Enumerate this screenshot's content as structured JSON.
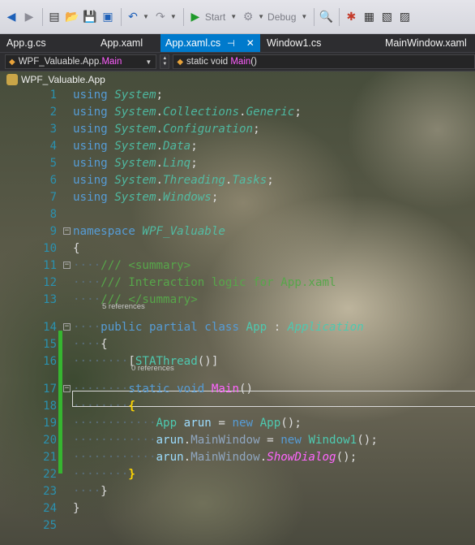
{
  "toolbar": {
    "start_label": "Start",
    "config_label": "Debug"
  },
  "tabs": [
    {
      "label": "App.g.cs",
      "active": false
    },
    {
      "label": "App.xaml",
      "active": false
    },
    {
      "label": "App.xaml.cs",
      "active": true
    },
    {
      "label": "Window1.cs",
      "active": false
    },
    {
      "label": "MainWindow.xaml",
      "active": false
    }
  ],
  "navbar": {
    "type_combo": {
      "ns": "WPF_Valuable",
      "cls": "App",
      "member": "Main"
    },
    "member_combo": {
      "prefix": "static void ",
      "name": "Main",
      "suffix": "()"
    }
  },
  "scope_label": "WPF_Valuable.App",
  "codelens": {
    "class_refs": "5 references",
    "main_refs": "0 references"
  },
  "colors": {
    "accent_tab": "#007acc",
    "line_numbers": "#2b91af",
    "keyword": "#569cd6",
    "type": "#4ec9b0",
    "comment": "#57a64a",
    "method": "#ff66ff",
    "changed_lines": "#36b530"
  },
  "lines": [
    {
      "n": "1",
      "parts": [
        {
          "t": "using ",
          "c": "kw"
        },
        {
          "t": "System",
          "c": "ns"
        },
        {
          "t": ";",
          "c": ""
        }
      ]
    },
    {
      "n": "2",
      "parts": [
        {
          "t": "using ",
          "c": "kw"
        },
        {
          "t": "System",
          "c": "ns"
        },
        {
          "t": ".",
          "c": ""
        },
        {
          "t": "Collections",
          "c": "ns"
        },
        {
          "t": ".",
          "c": ""
        },
        {
          "t": "Generic",
          "c": "ns"
        },
        {
          "t": ";",
          "c": ""
        }
      ]
    },
    {
      "n": "3",
      "parts": [
        {
          "t": "using ",
          "c": "kw"
        },
        {
          "t": "System",
          "c": "ns"
        },
        {
          "t": ".",
          "c": ""
        },
        {
          "t": "Configuration",
          "c": "ns"
        },
        {
          "t": ";",
          "c": ""
        }
      ]
    },
    {
      "n": "4",
      "parts": [
        {
          "t": "using ",
          "c": "kw"
        },
        {
          "t": "System",
          "c": "ns"
        },
        {
          "t": ".",
          "c": ""
        },
        {
          "t": "Data",
          "c": "ns"
        },
        {
          "t": ";",
          "c": ""
        }
      ]
    },
    {
      "n": "5",
      "parts": [
        {
          "t": "using ",
          "c": "kw"
        },
        {
          "t": "System",
          "c": "ns"
        },
        {
          "t": ".",
          "c": ""
        },
        {
          "t": "Linq",
          "c": "ns"
        },
        {
          "t": ";",
          "c": ""
        }
      ]
    },
    {
      "n": "6",
      "parts": [
        {
          "t": "using ",
          "c": "kw"
        },
        {
          "t": "System",
          "c": "ns"
        },
        {
          "t": ".",
          "c": ""
        },
        {
          "t": "Threading",
          "c": "ns"
        },
        {
          "t": ".",
          "c": ""
        },
        {
          "t": "Tasks",
          "c": "ns"
        },
        {
          "t": ";",
          "c": ""
        }
      ]
    },
    {
      "n": "7",
      "parts": [
        {
          "t": "using ",
          "c": "kw"
        },
        {
          "t": "System",
          "c": "ns"
        },
        {
          "t": ".",
          "c": ""
        },
        {
          "t": "Windows",
          "c": "ns"
        },
        {
          "t": ";",
          "c": ""
        }
      ]
    },
    {
      "n": "8",
      "parts": []
    },
    {
      "n": "9",
      "fold": "−",
      "parts": [
        {
          "t": "namespace ",
          "c": "kw"
        },
        {
          "t": "WPF_Valuable",
          "c": "ns"
        }
      ]
    },
    {
      "n": "10",
      "parts": [
        {
          "t": "{",
          "c": ""
        }
      ]
    },
    {
      "n": "11",
      "fold": "−",
      "parts": [
        {
          "t": "····",
          "c": "ws"
        },
        {
          "t": "/// <summary>",
          "c": "cm"
        }
      ]
    },
    {
      "n": "12",
      "parts": [
        {
          "t": "····",
          "c": "ws"
        },
        {
          "t": "/// Interaction logic for App.xaml",
          "c": "cm"
        }
      ]
    },
    {
      "n": "13",
      "parts": [
        {
          "t": "····",
          "c": "ws"
        },
        {
          "t": "/// </summary>",
          "c": "cm"
        }
      ]
    },
    {
      "n": "14",
      "fold": "−",
      "parts": [
        {
          "t": "····",
          "c": "ws"
        },
        {
          "t": "public partial class ",
          "c": "kw"
        },
        {
          "t": "App",
          "c": "ty"
        },
        {
          "t": " : ",
          "c": ""
        },
        {
          "t": "Application",
          "c": "tyi"
        }
      ]
    },
    {
      "n": "15",
      "parts": [
        {
          "t": "····",
          "c": "ws"
        },
        {
          "t": "{",
          "c": ""
        }
      ]
    },
    {
      "n": "16",
      "parts": [
        {
          "t": "········",
          "c": "ws"
        },
        {
          "t": "[",
          "c": ""
        },
        {
          "t": "STAThread",
          "c": "ty"
        },
        {
          "t": "()]",
          "c": ""
        }
      ]
    },
    {
      "n": "17",
      "fold": "−",
      "parts": [
        {
          "t": "········",
          "c": "ws"
        },
        {
          "t": "static void ",
          "c": "kw"
        },
        {
          "t": "Main",
          "c": "mt"
        },
        {
          "t": "()",
          "c": ""
        }
      ]
    },
    {
      "n": "18",
      "parts": [
        {
          "t": "········",
          "c": "ws"
        },
        {
          "t": "{",
          "c": "br"
        }
      ]
    },
    {
      "n": "19",
      "parts": [
        {
          "t": "············",
          "c": "ws"
        },
        {
          "t": "App",
          "c": "ty"
        },
        {
          "t": " ",
          "c": ""
        },
        {
          "t": "arun",
          "c": "id"
        },
        {
          "t": " = ",
          "c": ""
        },
        {
          "t": "new ",
          "c": "kw"
        },
        {
          "t": "App",
          "c": "ty"
        },
        {
          "t": "();",
          "c": ""
        }
      ]
    },
    {
      "n": "20",
      "parts": [
        {
          "t": "············",
          "c": "ws"
        },
        {
          "t": "arun",
          "c": "id"
        },
        {
          "t": ".",
          "c": ""
        },
        {
          "t": "MainWindow",
          "c": "pr"
        },
        {
          "t": " = ",
          "c": ""
        },
        {
          "t": "new ",
          "c": "kw"
        },
        {
          "t": "Window1",
          "c": "ty"
        },
        {
          "t": "();",
          "c": ""
        }
      ]
    },
    {
      "n": "21",
      "parts": [
        {
          "t": "············",
          "c": "ws"
        },
        {
          "t": "arun",
          "c": "id"
        },
        {
          "t": ".",
          "c": ""
        },
        {
          "t": "MainWindow",
          "c": "pr"
        },
        {
          "t": ".",
          "c": ""
        },
        {
          "t": "ShowDialog",
          "c": "mti"
        },
        {
          "t": "();",
          "c": ""
        }
      ]
    },
    {
      "n": "22",
      "parts": [
        {
          "t": "········",
          "c": "ws"
        },
        {
          "t": "}",
          "c": "br"
        }
      ]
    },
    {
      "n": "23",
      "parts": [
        {
          "t": "····",
          "c": "ws"
        },
        {
          "t": "}",
          "c": ""
        }
      ]
    },
    {
      "n": "24",
      "parts": [
        {
          "t": "}",
          "c": ""
        }
      ]
    },
    {
      "n": "25",
      "parts": []
    }
  ]
}
